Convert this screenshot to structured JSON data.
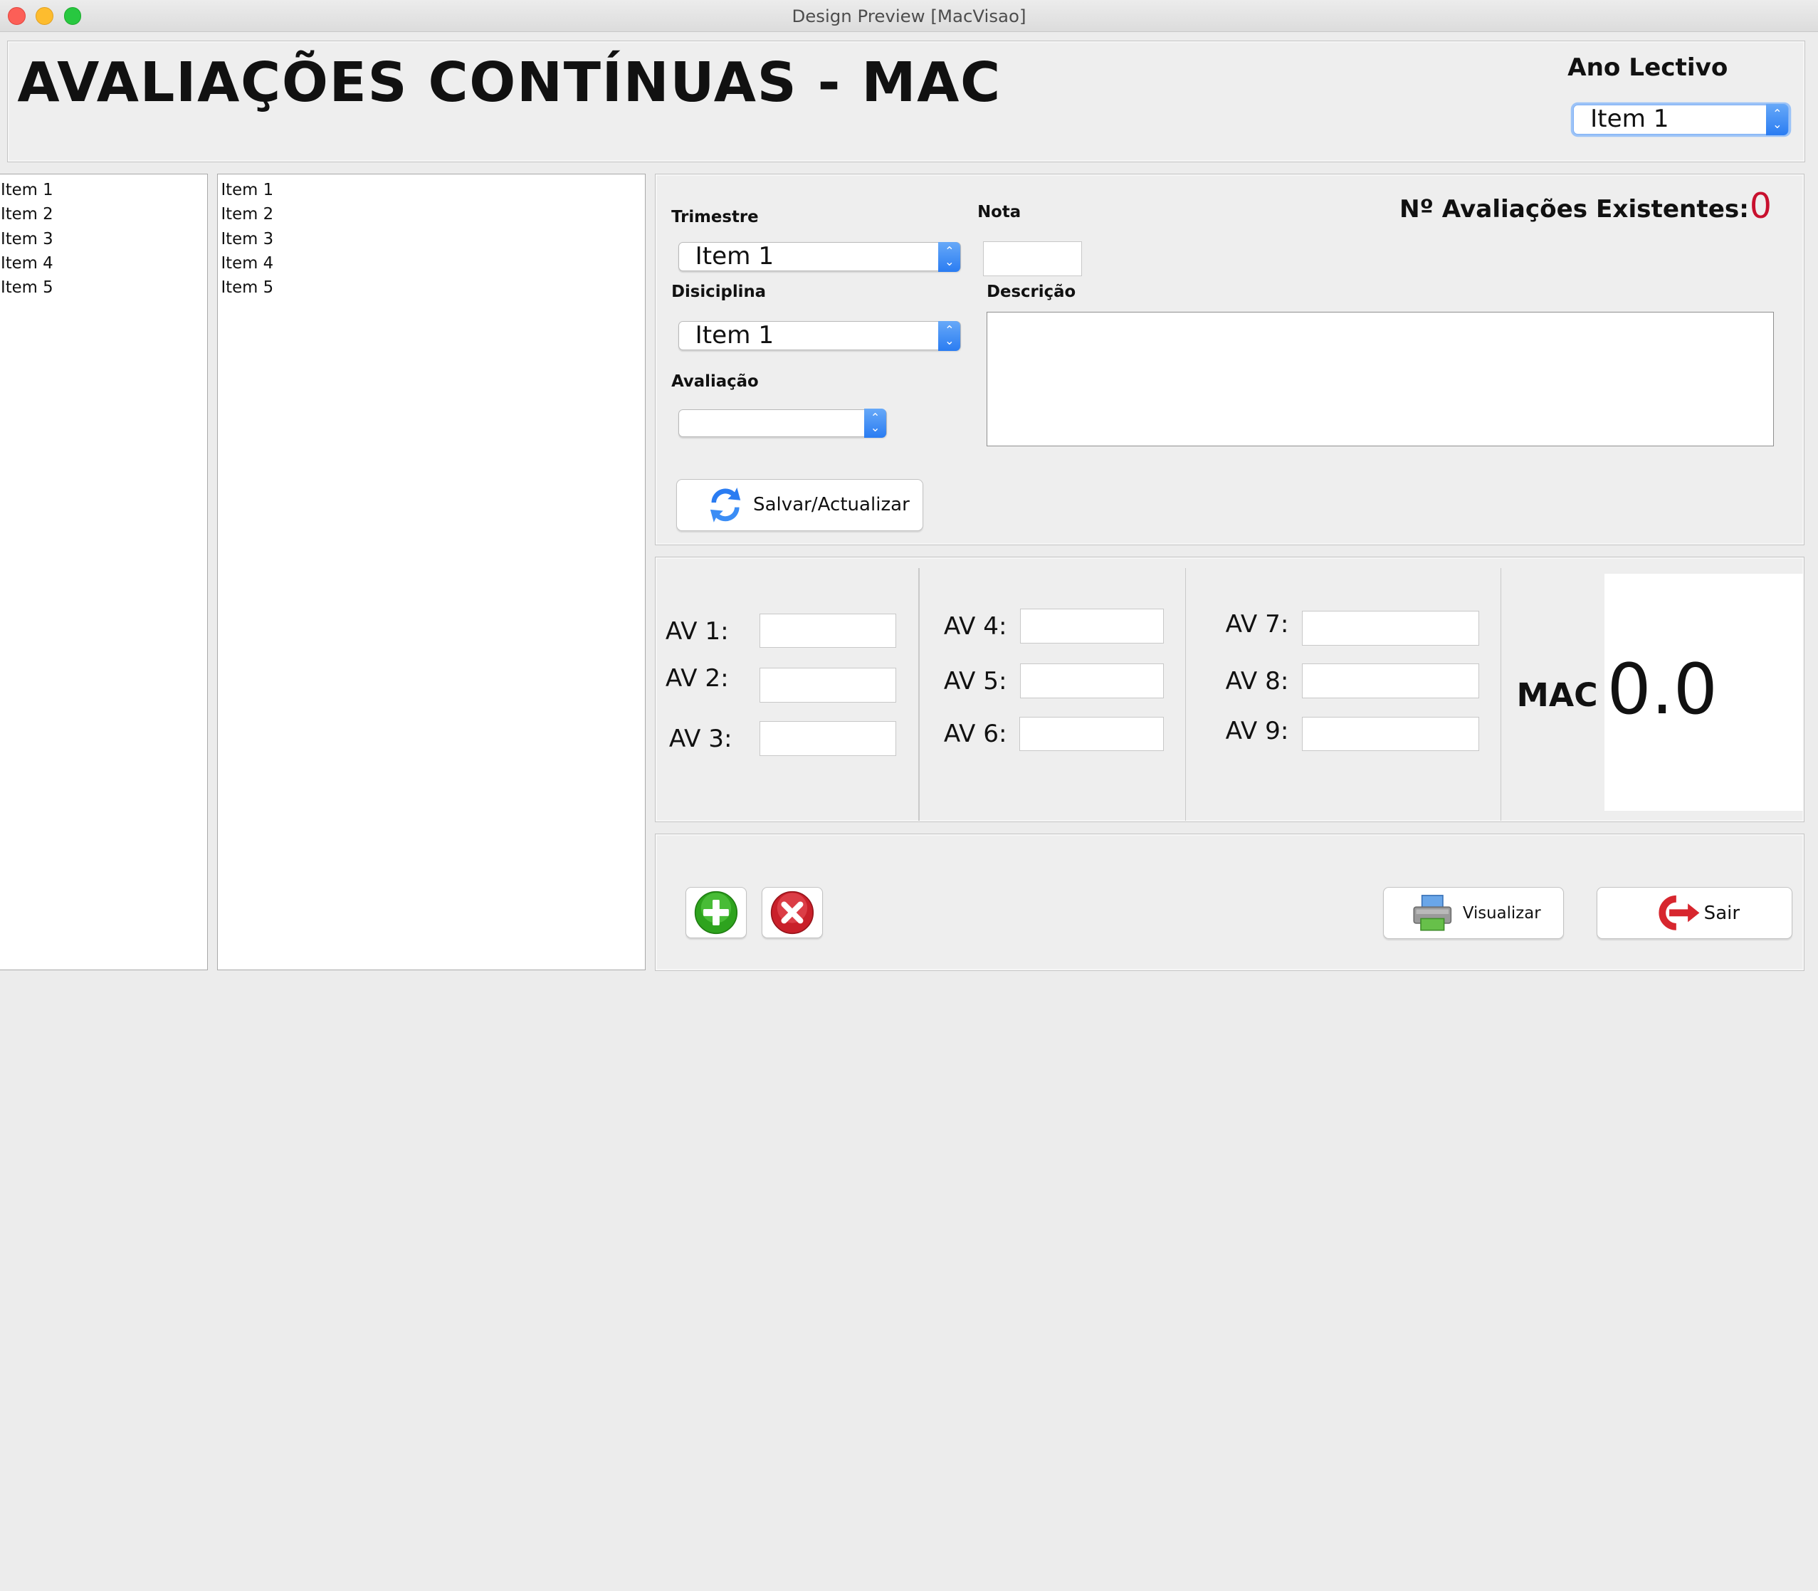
{
  "window": {
    "title": "Design Preview [MacVisao]"
  },
  "header": {
    "title": "AVALIAÇÕES CONTÍNUAS - MAC",
    "ano_lectivo_label": "Ano Lectivo",
    "ano_lectivo_value": "Item 1"
  },
  "left_list": [
    "Item 1",
    "Item 2",
    "Item 3",
    "Item 4",
    "Item 5"
  ],
  "middle_list": [
    "Item 1",
    "Item 2",
    "Item 3",
    "Item 4",
    "Item 5"
  ],
  "form": {
    "trimestre_label": "Trimestre",
    "trimestre_value": "Item 1",
    "nota_label": "Nota",
    "nota_value": "",
    "disciplina_label": "Disiciplina",
    "disciplina_value": "Item 1",
    "descricao_label": "Descrição",
    "descricao_value": "",
    "avaliacao_label": "Avaliação",
    "avaliacao_value": "",
    "existing_label": "Nº Avaliações Existentes:",
    "existing_count": "0",
    "save_button": "Salvar/Actualizar"
  },
  "grades": {
    "av1": "AV 1:",
    "av2": "AV 2:",
    "av3": "AV 3:",
    "av4": "AV 4:",
    "av5": "AV 5:",
    "av6": "AV 6:",
    "av7": "AV 7:",
    "av8": "AV 8:",
    "av9": "AV 9:",
    "mac_label": "MAC",
    "mac_value": "0.0"
  },
  "footer": {
    "preview_button": "Visualizar",
    "exit_button": "Sair"
  },
  "colors": {
    "count_red": "#c8102e",
    "accent_blue": "#2a7cf2"
  }
}
